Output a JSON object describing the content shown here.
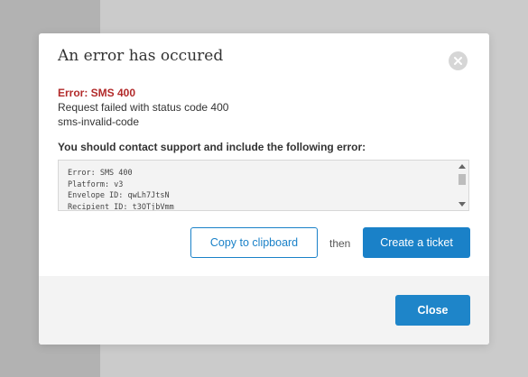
{
  "colors": {
    "accent": "#1a81c8",
    "error_red": "#b22a2a",
    "close_button_blue": "#1e85c9"
  },
  "modal": {
    "title": "An error has occured",
    "close_icon": "close-circle-icon",
    "error": {
      "title": "Error: SMS 400",
      "message": "Request failed with status code 400",
      "code": "sms-invalid-code"
    },
    "instruction": "You should contact support and include the following error:",
    "details": [
      "Error: SMS 400",
      "Platform: v3",
      "Envelope ID: qwLh7JtsN",
      "Recipient ID: t3OTjbVmm"
    ],
    "actions": {
      "copy_label": "Copy to clipboard",
      "then_label": "then",
      "ticket_label": "Create a ticket"
    },
    "footer": {
      "close_label": "Close"
    }
  }
}
